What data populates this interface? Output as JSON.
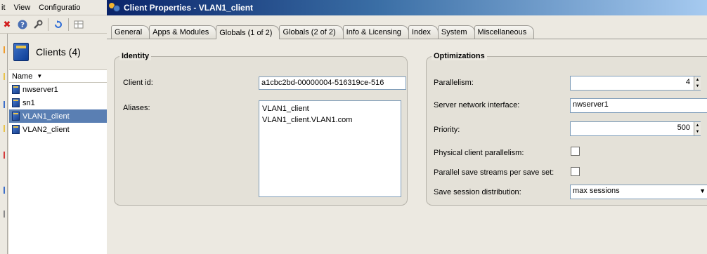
{
  "menu": {
    "items": [
      "it",
      "View",
      "Configuratio"
    ]
  },
  "left_panel": {
    "title": "Clients (4)",
    "column_header": "Name",
    "clients": [
      {
        "name": "nwserver1",
        "selected": false
      },
      {
        "name": "sn1",
        "selected": false
      },
      {
        "name": "VLAN1_client",
        "selected": true
      },
      {
        "name": "VLAN2_client",
        "selected": false
      }
    ]
  },
  "dialog": {
    "title": "Client Properties - VLAN1_client",
    "tabs": [
      {
        "label": "General",
        "active": false
      },
      {
        "label": "Apps & Modules",
        "active": false
      },
      {
        "label": "Globals (1 of 2)",
        "active": true
      },
      {
        "label": "Globals (2 of 2)",
        "active": false
      },
      {
        "label": "Info & Licensing",
        "active": false
      },
      {
        "label": "Index",
        "active": false
      },
      {
        "label": "System",
        "active": false
      },
      {
        "label": "Miscellaneous",
        "active": false
      }
    ],
    "identity": {
      "title": "Identity",
      "client_id_label": "Client id:",
      "client_id_value": "a1cbc2bd-00000004-516319ce-516",
      "aliases_label": "Aliases:",
      "aliases": [
        "VLAN1_client",
        "VLAN1_client.VLAN1.com"
      ]
    },
    "optimizations": {
      "title": "Optimizations",
      "parallelism_label": "Parallelism:",
      "parallelism_value": "4",
      "server_interface_label": "Server network interface:",
      "server_interface_value": "nwserver1",
      "priority_label": "Priority:",
      "priority_value": "500",
      "physical_parallelism_label": "Physical client parallelism:",
      "physical_parallelism_checked": false,
      "parallel_streams_label": "Parallel save streams per save set:",
      "parallel_streams_checked": false,
      "session_distribution_label": "Save session distribution:",
      "session_distribution_value": "max sessions"
    }
  }
}
